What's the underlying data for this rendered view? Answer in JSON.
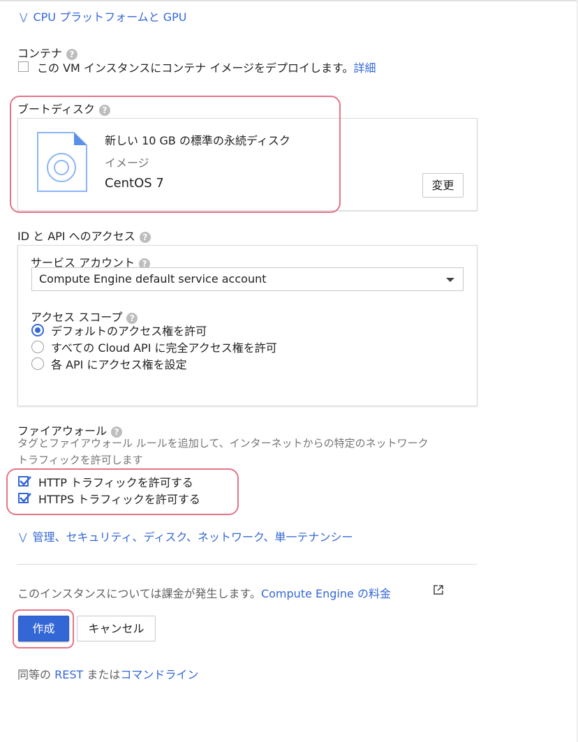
{
  "cpu_gpu_link": "CPU プラットフォームと GPU",
  "container": {
    "title": "コンテナ",
    "checkbox_label": "この VM インスタンスにコンテナ イメージをデプロイします。",
    "detail_link": "詳細"
  },
  "boot_disk": {
    "title": "ブートディスク",
    "disk_desc": "新しい 10 GB の標準の永続ディスク",
    "image_label": "イメージ",
    "image_name": "CentOS 7",
    "change_button": "変更",
    "icon": "disk-file-icon"
  },
  "identity": {
    "title": "ID と API へのアクセス",
    "service_account_label": "サービス アカウント",
    "service_account_value": "Compute Engine default service account",
    "access_scope_label": "アクセス スコープ",
    "scopes": [
      {
        "label": "デフォルトのアクセス権を許可",
        "selected": true
      },
      {
        "label": "すべての Cloud API に完全アクセス権を許可",
        "selected": false
      },
      {
        "label": "各 API にアクセス権を設定",
        "selected": false
      }
    ]
  },
  "firewall": {
    "title": "ファイアウォール",
    "description_line1": "タグとファイアウォール ルールを追加して、インターネットからの特定のネットワーク",
    "description_line2": "トラフィックを許可します",
    "http_label": "HTTP トラフィックを許可する",
    "https_label": "HTTPS トラフィックを許可する",
    "http_checked": true,
    "https_checked": true
  },
  "management_link": "管理、セキュリティ、ディスク、ネットワーク、単一テナンシー",
  "billing": {
    "text": "このインスタンスについては課金が発生します。",
    "link": "Compute Engine の料金"
  },
  "actions": {
    "create": "作成",
    "cancel": "キャンセル"
  },
  "footer": {
    "prefix": "同等の ",
    "rest_link": "REST",
    "middle": " または",
    "cli_link": "コマンドライン"
  },
  "colors": {
    "accent": "#3367d6",
    "annotation": "#e57387"
  }
}
